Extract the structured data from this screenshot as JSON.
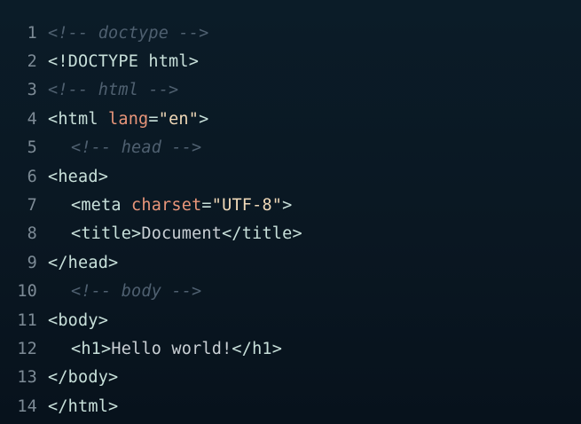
{
  "editor": {
    "lines": [
      {
        "n": "1",
        "comment": "<!-- doctype -->"
      },
      {
        "n": "2",
        "tag": "<!DOCTYPE html>"
      },
      {
        "n": "3",
        "comment": "<!-- html -->"
      },
      {
        "n": "4",
        "tag_open": "<html",
        "attr": "lang",
        "eq": "=",
        "val": "\"en\"",
        "tag_close": ">"
      },
      {
        "n": "5",
        "comment": "<!-- head -->"
      },
      {
        "n": "6",
        "tag": "<head>"
      },
      {
        "n": "7",
        "tag_open": "<meta",
        "attr": "charset",
        "eq": "=",
        "val": "\"UTF-8\"",
        "tag_close": ">"
      },
      {
        "n": "8",
        "tag_open": "<title>",
        "text": "Document",
        "tag_close": "</title>"
      },
      {
        "n": "9",
        "tag": "</head>"
      },
      {
        "n": "10",
        "comment": "<!-- body -->"
      },
      {
        "n": "11",
        "tag": "<body>"
      },
      {
        "n": "12",
        "tag_open": "<h1>",
        "text": "Hello world!",
        "tag_close": "</h1>"
      },
      {
        "n": "13",
        "tag": "</body>"
      },
      {
        "n": "14",
        "tag": "</html>"
      }
    ]
  },
  "colors": {
    "background": "#0a1722",
    "line_number": "#7d8b96",
    "comment": "#4f6070",
    "tag": "#c8e0da",
    "attribute": "#e9967a",
    "string": "#f0d9b8",
    "text": "#c9cfd4"
  }
}
